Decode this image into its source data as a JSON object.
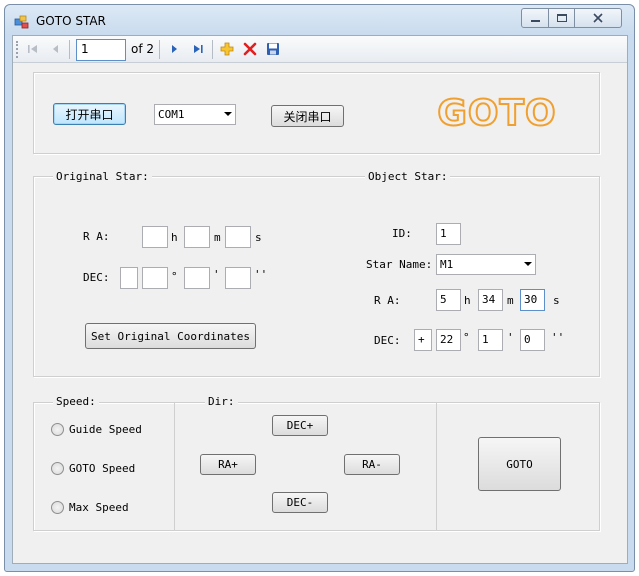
{
  "window": {
    "title": "GOTO STAR"
  },
  "toolbar": {
    "page_value": "1",
    "page_of": "of 2",
    "icons": [
      "move-first-icon",
      "move-previous-icon",
      "move-next-icon",
      "move-last-icon",
      "add-new-icon",
      "delete-icon",
      "save-icon"
    ]
  },
  "serial": {
    "open_label": "打开串口",
    "port_value": "COM1",
    "close_label": "关闭串口",
    "logo_text": "GOTO"
  },
  "original": {
    "group_title": "Original Star:",
    "ra_label": "R A:",
    "ra_h_unit": "h",
    "ra_m_unit": "m",
    "ra_s_unit": "s",
    "dec_label": "DEC:",
    "dec_deg_unit": "°",
    "dec_min_unit": "'",
    "dec_sec_unit": "''",
    "set_button": "Set Original Coordinates"
  },
  "object": {
    "group_title": "Object Star:",
    "id_label": "ID:",
    "id_value": "1",
    "name_label": "Star Name:",
    "name_value": "M1",
    "ra_label": "R A:",
    "ra_h": "5",
    "ra_h_unit": "h",
    "ra_m": "34",
    "ra_m_unit": "m",
    "ra_s": "30",
    "ra_s_unit": "s",
    "dec_label": "DEC:",
    "dec_sign": "+",
    "dec_deg": "22",
    "dec_deg_unit": "°",
    "dec_min": "1",
    "dec_min_unit": "'",
    "dec_sec": "0",
    "dec_sec_unit": "''"
  },
  "speed": {
    "group_title": "Speed:",
    "guide": "Guide Speed",
    "goto": "GOTO Speed",
    "max": "Max Speed"
  },
  "dir": {
    "group_title": "Dir:",
    "dec_plus": "DEC+",
    "ra_plus": "RA+",
    "ra_minus": "RA-",
    "dec_minus": "DEC-"
  },
  "goto_button": "GOTO",
  "colors": {
    "logo_orange": "#f0a030",
    "accent_blue": "#3c7fb1"
  }
}
